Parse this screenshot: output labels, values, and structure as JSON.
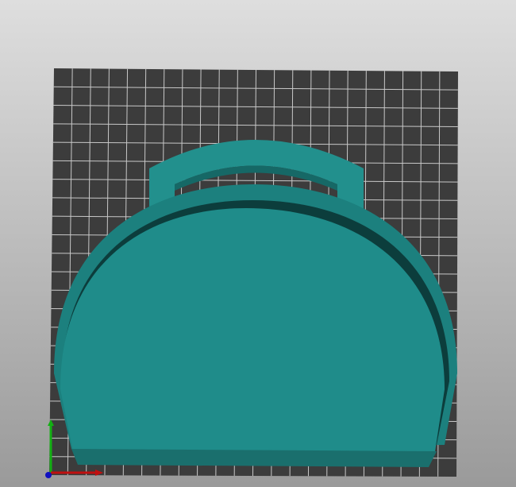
{
  "viewport": {
    "background_top": "#d9d9d9",
    "background_bottom": "#9c9c9c",
    "bed_color": "#3c3c3c",
    "grid_color": "#cfcfcf",
    "model_color": "#1f8c8a",
    "model_rim_color": "#1a7a78",
    "model_shadow_color": "#0b3a39",
    "axis_x_color": "#c01010",
    "axis_y_color": "#10b010",
    "axis_z_color": "#1010c0"
  }
}
